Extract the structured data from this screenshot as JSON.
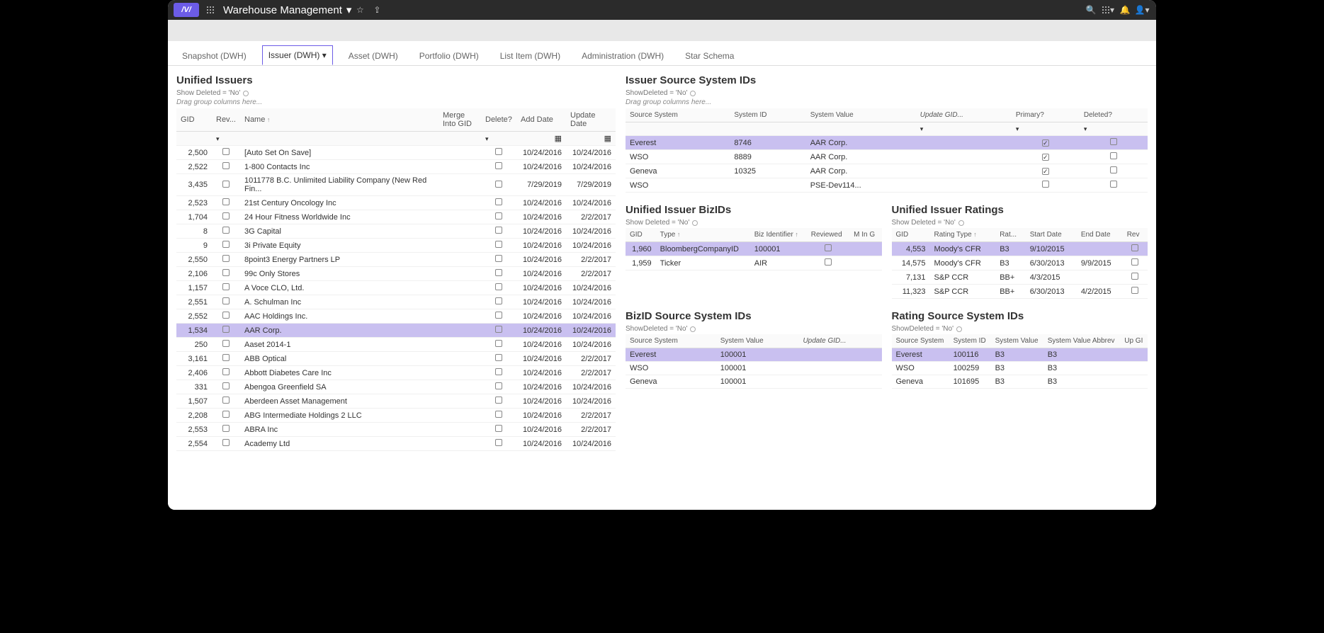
{
  "app_title": "Warehouse Management",
  "tabs": [
    {
      "label": "Snapshot (DWH)",
      "active": false
    },
    {
      "label": "Issuer (DWH)",
      "active": true
    },
    {
      "label": "Asset (DWH)",
      "active": false
    },
    {
      "label": "Portfolio (DWH)",
      "active": false
    },
    {
      "label": "List Item (DWH)",
      "active": false
    },
    {
      "label": "Administration (DWH)",
      "active": false
    },
    {
      "label": "Star Schema",
      "active": false
    }
  ],
  "unified_issuers": {
    "title": "Unified Issuers",
    "filter": "Show Deleted = 'No'",
    "drag_hint": "Drag group columns here...",
    "headers": {
      "gid": "GID",
      "rev": "Rev...",
      "name": "Name",
      "merge": "Merge Into GID",
      "delete": "Delete?",
      "add": "Add Date",
      "update": "Update Date"
    },
    "rows": [
      {
        "gid": "2,500",
        "name": "[Auto Set On Save]",
        "add": "10/24/2016",
        "update": "10/24/2016"
      },
      {
        "gid": "2,522",
        "name": "1-800 Contacts Inc",
        "add": "10/24/2016",
        "update": "10/24/2016"
      },
      {
        "gid": "3,435",
        "name": "1011778 B.C. Unlimited Liability Company (New Red Fin...",
        "add": "7/29/2019",
        "update": "7/29/2019"
      },
      {
        "gid": "2,523",
        "name": "21st Century Oncology Inc",
        "add": "10/24/2016",
        "update": "10/24/2016"
      },
      {
        "gid": "1,704",
        "name": "24 Hour Fitness Worldwide Inc",
        "add": "10/24/2016",
        "update": "2/2/2017"
      },
      {
        "gid": "8",
        "name": "3G Capital",
        "add": "10/24/2016",
        "update": "10/24/2016"
      },
      {
        "gid": "9",
        "name": "3i Private Equity",
        "add": "10/24/2016",
        "update": "10/24/2016"
      },
      {
        "gid": "2,550",
        "name": "8point3 Energy Partners LP",
        "add": "10/24/2016",
        "update": "2/2/2017"
      },
      {
        "gid": "2,106",
        "name": "99c Only Stores",
        "add": "10/24/2016",
        "update": "2/2/2017"
      },
      {
        "gid": "1,157",
        "name": "A Voce CLO, Ltd.",
        "add": "10/24/2016",
        "update": "10/24/2016"
      },
      {
        "gid": "2,551",
        "name": "A. Schulman Inc",
        "add": "10/24/2016",
        "update": "10/24/2016"
      },
      {
        "gid": "2,552",
        "name": "AAC Holdings Inc.",
        "add": "10/24/2016",
        "update": "10/24/2016"
      },
      {
        "gid": "1,534",
        "name": "AAR Corp.",
        "add": "10/24/2016",
        "update": "10/24/2016",
        "sel": true
      },
      {
        "gid": "250",
        "name": "Aaset 2014-1",
        "add": "10/24/2016",
        "update": "10/24/2016"
      },
      {
        "gid": "3,161",
        "name": "ABB Optical",
        "add": "10/24/2016",
        "update": "2/2/2017"
      },
      {
        "gid": "2,406",
        "name": "Abbott Diabetes Care Inc",
        "add": "10/24/2016",
        "update": "2/2/2017"
      },
      {
        "gid": "331",
        "name": "Abengoa Greenfield SA",
        "add": "10/24/2016",
        "update": "10/24/2016"
      },
      {
        "gid": "1,507",
        "name": "Aberdeen Asset Management",
        "add": "10/24/2016",
        "update": "10/24/2016"
      },
      {
        "gid": "2,208",
        "name": "ABG Intermediate Holdings 2 LLC",
        "add": "10/24/2016",
        "update": "2/2/2017"
      },
      {
        "gid": "2,553",
        "name": "ABRA Inc",
        "add": "10/24/2016",
        "update": "2/2/2017"
      },
      {
        "gid": "2,554",
        "name": "Academy Ltd",
        "add": "10/24/2016",
        "update": "10/24/2016"
      }
    ]
  },
  "issuer_ids": {
    "title": "Issuer Source System IDs",
    "filter": "ShowDeleted = 'No'",
    "drag_hint": "Drag group columns here...",
    "headers": {
      "source": "Source System",
      "sysid": "System ID",
      "sysval": "System Value",
      "update": "Update GID...",
      "primary": "Primary?",
      "deleted": "Deleted?"
    },
    "rows": [
      {
        "source": "Everest",
        "sysid": "8746",
        "sysval": "AAR Corp.",
        "primary": true,
        "deleted": false,
        "sel": true
      },
      {
        "source": "WSO",
        "sysid": "8889",
        "sysval": "AAR Corp.",
        "primary": true,
        "deleted": false
      },
      {
        "source": "Geneva",
        "sysid": "10325",
        "sysval": "AAR Corp.",
        "primary": true,
        "deleted": false
      },
      {
        "source": "WSO",
        "sysid": "",
        "sysval": "PSE-Dev114...",
        "primary": false,
        "deleted": false
      }
    ]
  },
  "bizids": {
    "title": "Unified Issuer BizIDs",
    "filter": "Show Deleted = 'No'",
    "headers": {
      "gid": "GID",
      "type": "Type",
      "bizident": "Biz Identifier",
      "reviewed": "Reviewed",
      "mg": "M In G"
    },
    "rows": [
      {
        "gid": "1,960",
        "type": "BloombergCompanyID",
        "bizident": "100001",
        "sel": true
      },
      {
        "gid": "1,959",
        "type": "Ticker",
        "bizident": "AIR"
      }
    ]
  },
  "ratings": {
    "title": "Unified Issuer Ratings",
    "filter": "Show Deleted = 'No'",
    "headers": {
      "gid": "GID",
      "rtype": "Rating Type",
      "rat": "Rat...",
      "start": "Start Date",
      "end": "End Date",
      "rev": "Rev"
    },
    "rows": [
      {
        "gid": "4,553",
        "rtype": "Moody's CFR",
        "rat": "B3",
        "start": "9/10/2015",
        "end": "",
        "sel": true
      },
      {
        "gid": "14,575",
        "rtype": "Moody's CFR",
        "rat": "B3",
        "start": "6/30/2013",
        "end": "9/9/2015"
      },
      {
        "gid": "7,131",
        "rtype": "S&P CCR",
        "rat": "BB+",
        "start": "4/3/2015",
        "end": ""
      },
      {
        "gid": "11,323",
        "rtype": "S&P CCR",
        "rat": "BB+",
        "start": "6/30/2013",
        "end": "4/2/2015"
      }
    ]
  },
  "bizid_source": {
    "title": "BizID Source System IDs",
    "filter": "ShowDeleted = 'No'",
    "headers": {
      "source": "Source System",
      "sysval": "System Value",
      "update": "Update GID..."
    },
    "rows": [
      {
        "source": "Everest",
        "sysval": "100001",
        "sel": true
      },
      {
        "source": "WSO",
        "sysval": "100001"
      },
      {
        "source": "Geneva",
        "sysval": "100001"
      }
    ]
  },
  "rating_source": {
    "title": "Rating Source System IDs",
    "filter": "ShowDeleted = 'No'",
    "headers": {
      "source": "Source System",
      "sysid": "System ID",
      "sysval": "System Value",
      "abbrev": "System Value Abbrev",
      "up": "Up GI"
    },
    "rows": [
      {
        "source": "Everest",
        "sysid": "100116",
        "sysval": "B3",
        "abbrev": "B3",
        "sel": true
      },
      {
        "source": "WSO",
        "sysid": "100259",
        "sysval": "B3",
        "abbrev": "B3"
      },
      {
        "source": "Geneva",
        "sysid": "101695",
        "sysval": "B3",
        "abbrev": "B3"
      }
    ]
  }
}
